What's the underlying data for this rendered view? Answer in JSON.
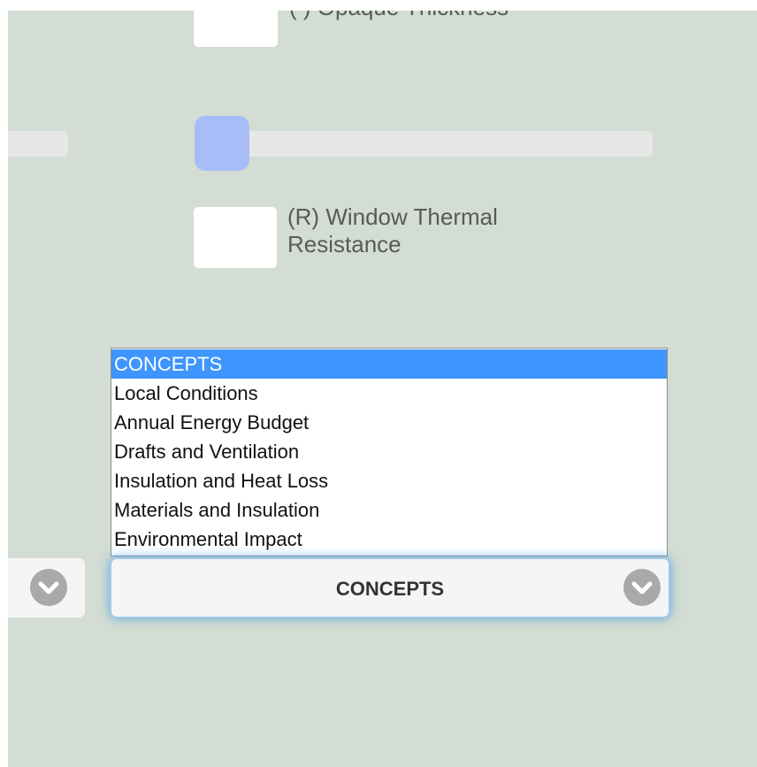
{
  "controls": {
    "opaque_label": "( ) Opaque Thickness",
    "window_label": "(R) Window Thermal Resistance",
    "slider_value": 0
  },
  "menu": {
    "options": [
      "CONCEPTS",
      "Local Conditions",
      "Annual Energy Budget",
      "Drafts and Ventilation",
      "Insulation and Heat Loss",
      "Materials and Insulation",
      "Environmental Impact"
    ],
    "selected_value": "CONCEPTS"
  },
  "icons": {
    "chevron": "chevron-down-icon"
  },
  "colors": {
    "background": "#d3ddd3",
    "highlight": "#3f95fe",
    "slider_thumb": "#a8bcf8",
    "focus_glow": "#3c96dc"
  }
}
